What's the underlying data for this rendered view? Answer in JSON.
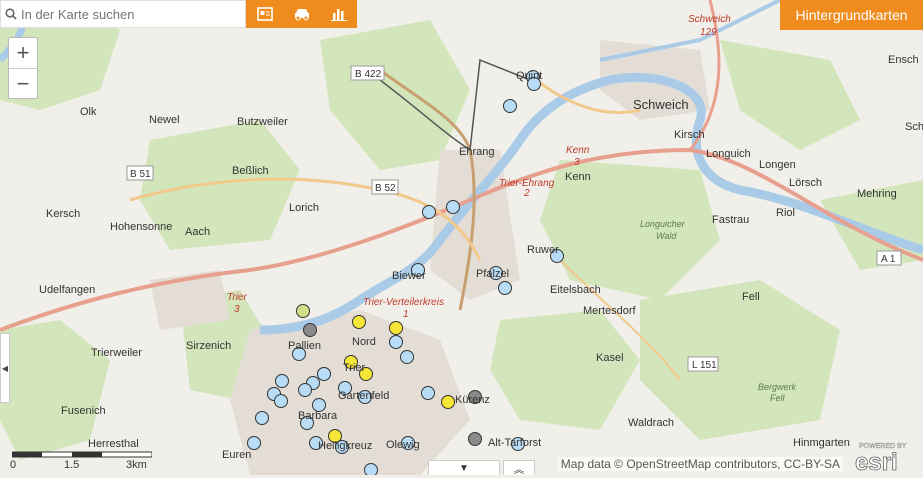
{
  "search": {
    "placeholder": "In der Karte suchen"
  },
  "toolbar": {
    "icons": [
      "report-icon",
      "car-icon",
      "bar-chart-icon"
    ]
  },
  "basemaps_label": "Hintergrundkarten",
  "zoom": {
    "in": "+",
    "out": "−"
  },
  "scale": {
    "labels": [
      "0",
      "1.5",
      "3km"
    ]
  },
  "attribution": "Map data © OpenStreetMap contributors, CC-BY-SA",
  "logo": {
    "powered": "POWERED BY",
    "name": "esri"
  },
  "colors": {
    "orange": "#f08c1e",
    "marker_blue": "#b8dcf5",
    "marker_yellow": "#f5e637",
    "marker_gray": "#8a8a8a",
    "marker_lightgreen": "#d2e08a",
    "river": "#a9cbe8",
    "forest": "#cfe3b6"
  },
  "labels": [
    {
      "text": "Olk",
      "kind": "place"
    },
    {
      "text": "Newel",
      "kind": "place"
    },
    {
      "text": "Butzweiler",
      "kind": "place"
    },
    {
      "text": "Beßlich",
      "kind": "place"
    },
    {
      "text": "Lorich",
      "kind": "place"
    },
    {
      "text": "Kersch",
      "kind": "place"
    },
    {
      "text": "Hohensonne",
      "kind": "place"
    },
    {
      "text": "Aach",
      "kind": "place"
    },
    {
      "text": "Udelfangen",
      "kind": "place"
    },
    {
      "text": "Sirzenich",
      "kind": "place"
    },
    {
      "text": "Trierweiler",
      "kind": "place"
    },
    {
      "text": "Fusenich",
      "kind": "place"
    },
    {
      "text": "Herresthal",
      "kind": "place"
    },
    {
      "text": "Euren",
      "kind": "place"
    },
    {
      "text": "Pallien",
      "kind": "place"
    },
    {
      "text": "Nord",
      "kind": "place"
    },
    {
      "text": "Trier",
      "kind": "place"
    },
    {
      "text": "Gartenfeld",
      "kind": "place"
    },
    {
      "text": "Barbara",
      "kind": "place"
    },
    {
      "text": "Heiligkreuz",
      "kind": "place"
    },
    {
      "text": "Olewig",
      "kind": "place"
    },
    {
      "text": "Alt-Tarforst",
      "kind": "place"
    },
    {
      "text": "Kürenz",
      "kind": "place"
    },
    {
      "text": "Biewer",
      "kind": "place"
    },
    {
      "text": "Pfalzel",
      "kind": "place"
    },
    {
      "text": "Ehrang",
      "kind": "place"
    },
    {
      "text": "Quint",
      "kind": "place"
    },
    {
      "text": "Schweich",
      "kind": "town"
    },
    {
      "text": "Kirsch",
      "kind": "place"
    },
    {
      "text": "Longuich",
      "kind": "place"
    },
    {
      "text": "Longen",
      "kind": "place"
    },
    {
      "text": "Lörsch",
      "kind": "place"
    },
    {
      "text": "Mehring",
      "kind": "place"
    },
    {
      "text": "Riol",
      "kind": "place"
    },
    {
      "text": "Fastrau",
      "kind": "place"
    },
    {
      "text": "Kenn",
      "kind": "place"
    },
    {
      "text": "Ruwer",
      "kind": "place"
    },
    {
      "text": "Eitelsbach",
      "kind": "place"
    },
    {
      "text": "Mertesdorf",
      "kind": "place"
    },
    {
      "text": "Kasel",
      "kind": "place"
    },
    {
      "text": "Waldrach",
      "kind": "place"
    },
    {
      "text": "Hinmgarten",
      "kind": "place"
    },
    {
      "text": "Fell",
      "kind": "place"
    },
    {
      "text": "Ensch",
      "kind": "place"
    },
    {
      "text": "Schl",
      "kind": "place"
    },
    {
      "text": "Schweich",
      "kind": "road-label"
    },
    {
      "text": "129",
      "kind": "road-label"
    },
    {
      "text": "Kenn",
      "kind": "road-label"
    },
    {
      "text": "3",
      "kind": "road-label"
    },
    {
      "text": "Trier-Ehrang",
      "kind": "road-label"
    },
    {
      "text": "2",
      "kind": "road-label"
    },
    {
      "text": "Trier-Verteilerkreis",
      "kind": "road-label"
    },
    {
      "text": "1",
      "kind": "road-label"
    },
    {
      "text": "Trier",
      "kind": "road-label"
    },
    {
      "text": "3",
      "kind": "road-label"
    },
    {
      "text": "Longuicher",
      "kind": "forest"
    },
    {
      "text": "Wald",
      "kind": "forest"
    },
    {
      "text": "Bergwerk",
      "kind": "forest"
    },
    {
      "text": "Fell",
      "kind": "forest"
    }
  ],
  "road_shields": [
    "B 422",
    "B 51",
    "B 52",
    "A 1",
    "L 151"
  ]
}
